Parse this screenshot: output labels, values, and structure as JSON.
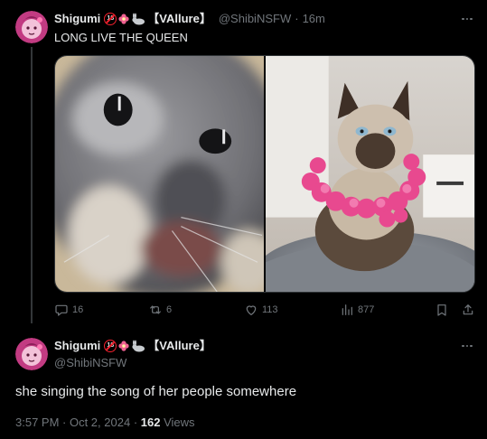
{
  "tweet": {
    "display_name": "Shigumi",
    "badge_18": "18",
    "brand": "【VAllure】",
    "handle": "@ShibiNSFW",
    "separator": "·",
    "time": "16m",
    "text": "LONG LIVE THE QUEEN",
    "stats": {
      "replies": "16",
      "reposts": "6",
      "likes": "113",
      "views": "877"
    }
  },
  "reply": {
    "display_name": "Shigumi",
    "badge_18": "18",
    "brand": "【VAllure】",
    "handle": "@ShibiNSFW",
    "text": "she singing the song of her people somewhere",
    "timestamp": "3:57 PM · Oct 2, 2024",
    "separator": "·",
    "views_count": "162",
    "views_label": "Views"
  },
  "icons": {
    "reply": "speech-bubble-icon",
    "repost": "repost-arrows-icon",
    "like": "heart-icon",
    "views": "bar-chart-icon",
    "bookmark": "bookmark-icon",
    "share": "share-icon",
    "more": "more-dots-icon"
  },
  "colors": {
    "background": "#000000",
    "text": "#e7e9ea",
    "muted": "#71767b",
    "accent_pink": "#d83a86"
  }
}
